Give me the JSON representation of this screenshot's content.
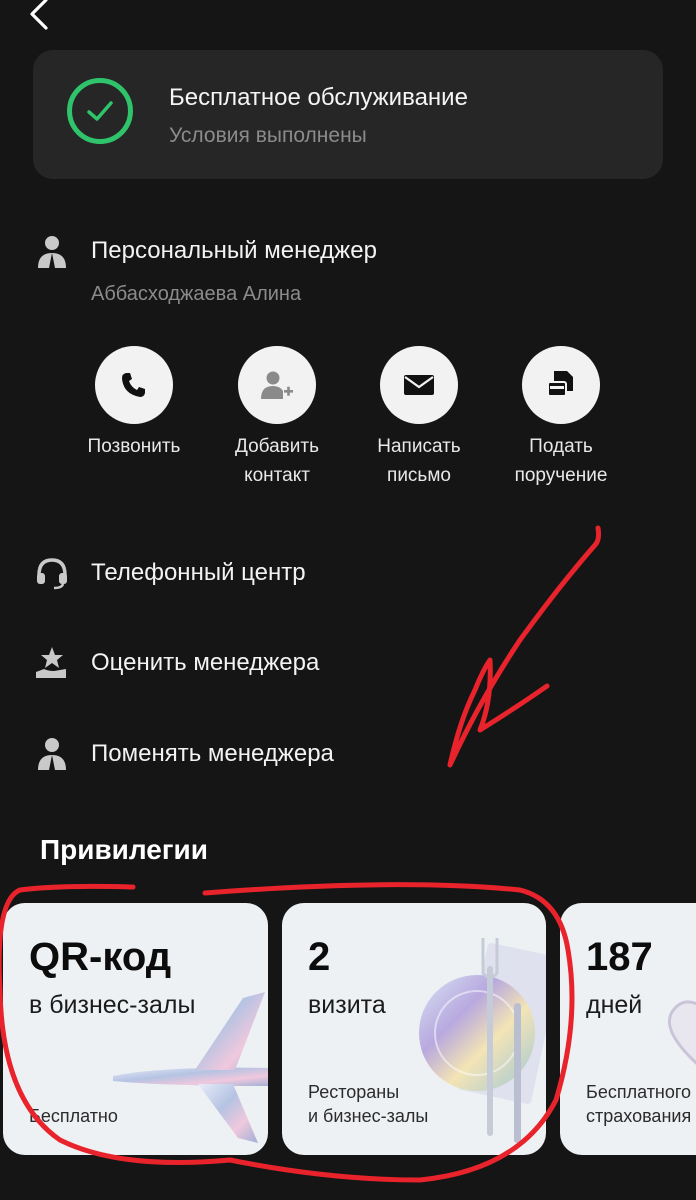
{
  "status": {
    "title": "Бесплатное обслуживание",
    "subtitle": "Условия выполнены"
  },
  "manager": {
    "title": "Персональный менеджер",
    "name": "Аббасходжаева Алина"
  },
  "actions": [
    {
      "label": "Позвонить",
      "icon": "phone-icon"
    },
    {
      "label": "Добавить\nконтакт",
      "icon": "add-contact-icon"
    },
    {
      "label": "Написать\nписьмо",
      "icon": "mail-icon"
    },
    {
      "label": "Подать\nпоручение",
      "icon": "document-icon"
    }
  ],
  "menu": [
    {
      "label": "Телефонный центр",
      "icon": "headset-icon"
    },
    {
      "label": "Оценить менеджера",
      "icon": "rate-star-icon"
    },
    {
      "label": "Поменять менеджера",
      "icon": "person-icon"
    }
  ],
  "privileges": {
    "title": "Привилегии",
    "cards": [
      {
        "big": "QR-код",
        "mid": "в бизнес-залы",
        "small": "Бесплатно"
      },
      {
        "big": "2",
        "mid": "визита",
        "small": "Рестораны\nи бизнес-залы"
      },
      {
        "big": "187",
        "mid": "дней",
        "small": "Бесплатного\nстрахования"
      }
    ]
  },
  "colors": {
    "background": "#151515",
    "card": "#262626",
    "success": "#2fc36b",
    "annotation": "#e8232b"
  }
}
